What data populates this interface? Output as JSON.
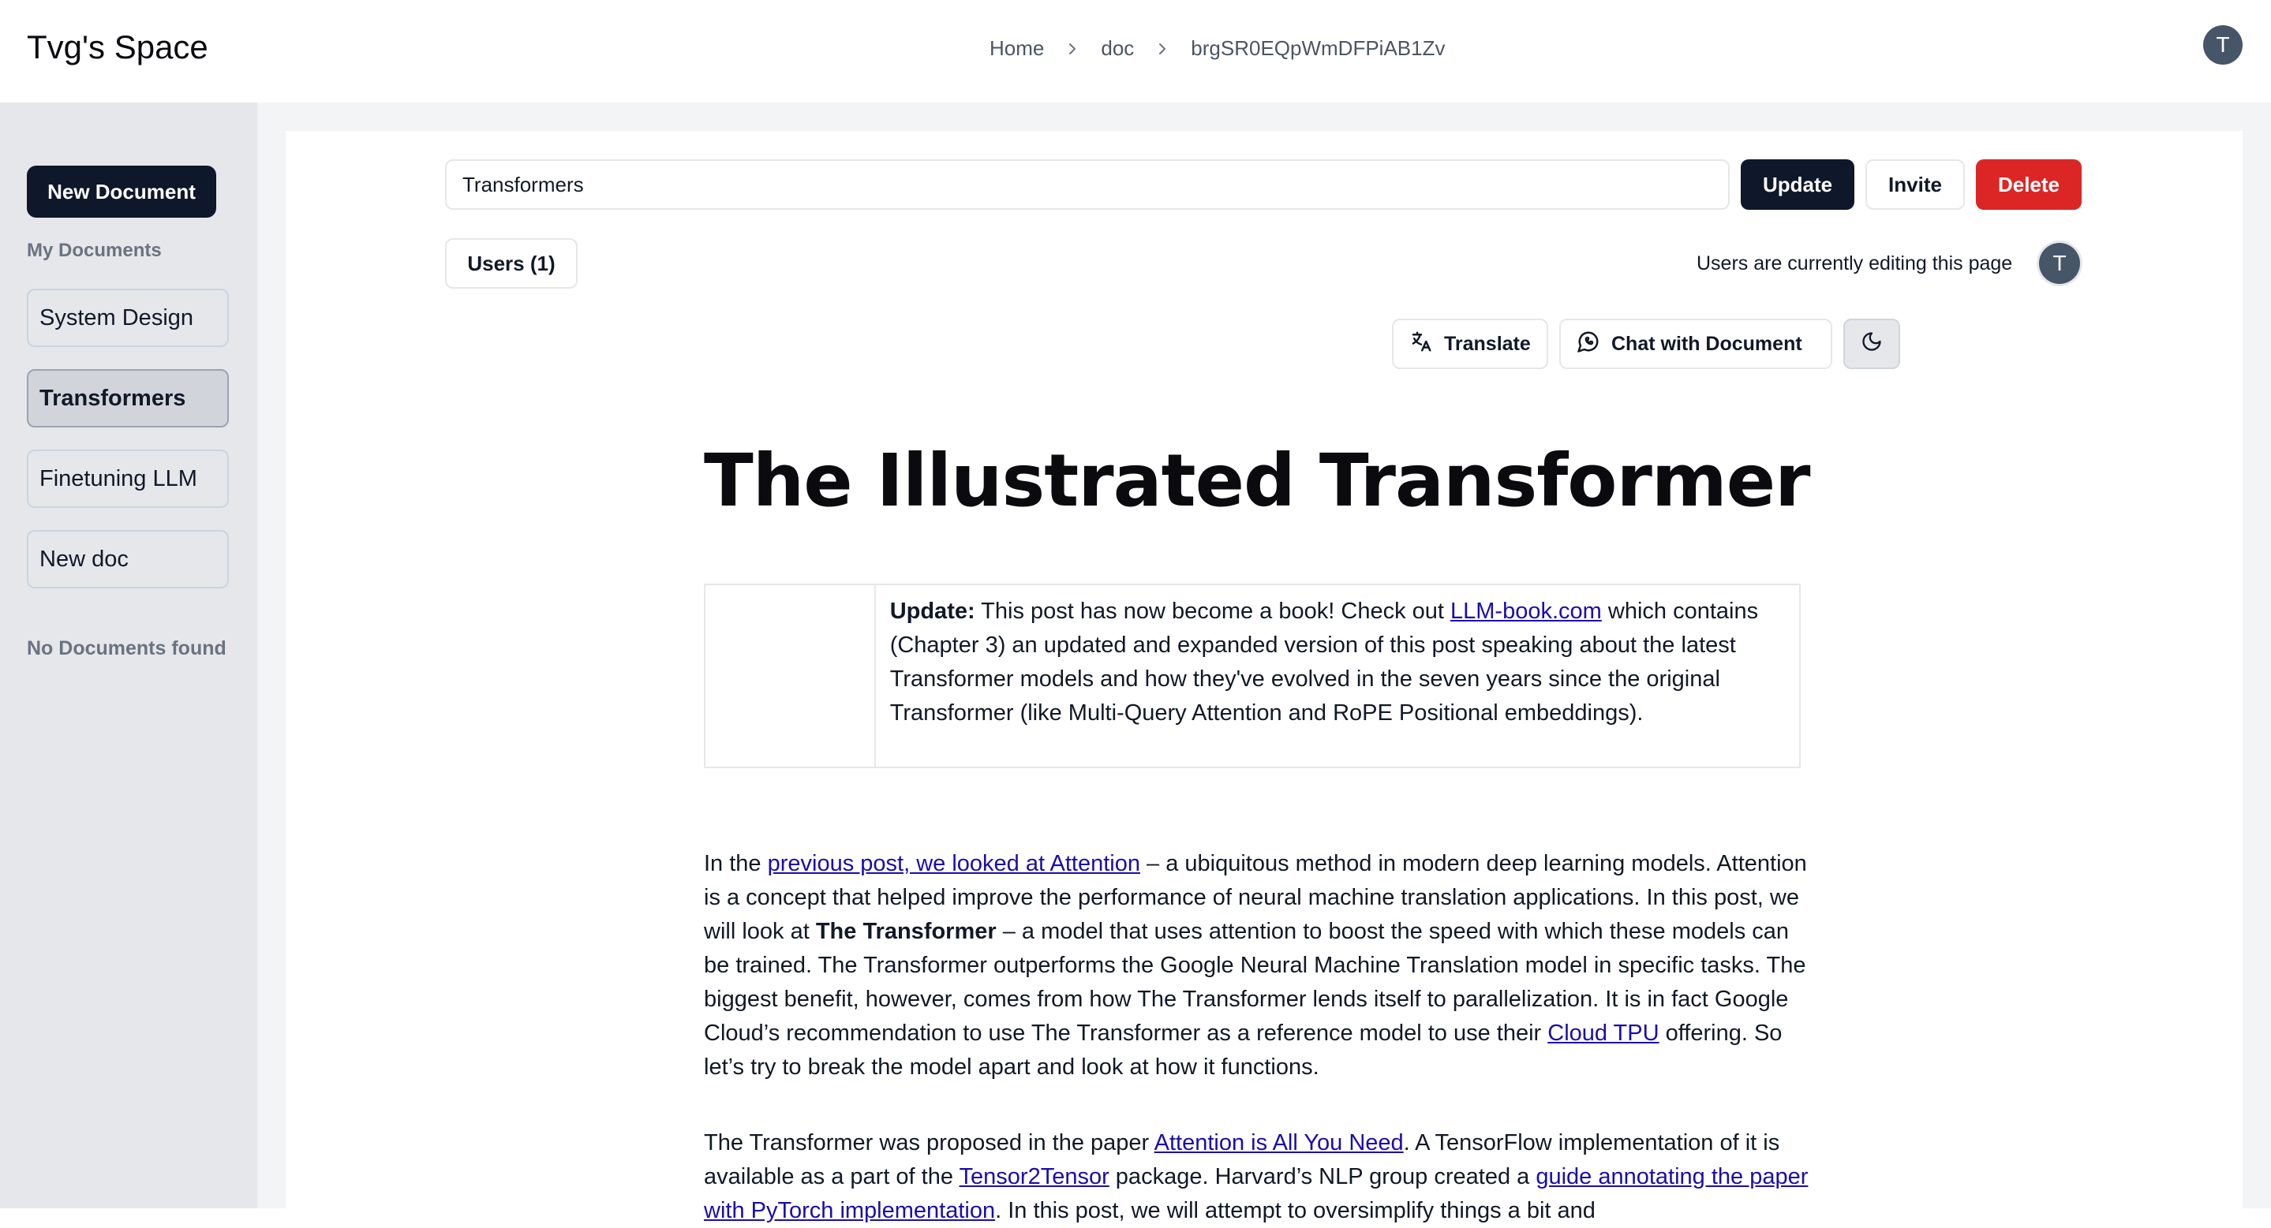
{
  "header": {
    "brand": "Tvg's Space",
    "breadcrumb": [
      "Home",
      "doc",
      "brgSR0EQpWmDFPiAB1Zv"
    ],
    "avatar_initial": "T"
  },
  "sidebar": {
    "new_document_label": "New Document",
    "my_documents_label": "My Documents",
    "items": [
      {
        "label": "System Design",
        "active": false
      },
      {
        "label": "Transformers",
        "active": true
      },
      {
        "label": "Finetuning LLM",
        "active": false
      },
      {
        "label": "New doc",
        "active": false
      }
    ],
    "empty_label": "No Documents found"
  },
  "toolbar": {
    "title_value": "Transformers",
    "update_label": "Update",
    "invite_label": "Invite",
    "delete_label": "Delete",
    "users_label": "Users (1)",
    "editing_text": "Users are currently editing this page",
    "editing_avatar_initial": "T",
    "translate_label": "Translate",
    "chat_label": "Chat with Document"
  },
  "document": {
    "title": "The Illustrated Transformer",
    "update_box": {
      "bold_prefix": "Update:",
      "text_1": " This post has now become a book! Check out ",
      "link": "LLM-book.com",
      "text_2": " which contains (Chapter 3) an updated and expanded version of this post speaking about the latest Transformer models and how they've evolved in the seven years since the original Transformer (like Multi-Query Attention and RoPE Positional embeddings)."
    },
    "p1": {
      "t1": "In the ",
      "link1": "previous post, we looked at Attention",
      "t2": " – a ubiquitous method in modern deep learning models. Attention is a concept that helped improve the performance of neural machine translation applications. In this post, we will look at ",
      "bold": "The Transformer",
      "t3": " – a model that uses attention to boost the speed with which these models can be trained. The Transformer outperforms the Google Neural Machine Translation model in specific tasks. The biggest benefit, however, comes from how The Transformer lends itself to parallelization. It is in fact Google Cloud’s recommendation to use The Transformer as a reference model to use their ",
      "link2": "Cloud TPU",
      "t4": " offering. So let’s try to break the model apart and look at how it functions."
    },
    "p2": {
      "t1": "The Transformer was proposed in the paper ",
      "link1": "Attention is All You Need",
      "t2": ". A TensorFlow implementation of it is available as a part of the ",
      "link2": "Tensor2Tensor",
      "t3": " package. Harvard’s NLP group created a ",
      "link3": "guide annotating the paper with PyTorch implementation",
      "t4": ". In this post, we will attempt to oversimplify things a bit and"
    }
  },
  "colors": {
    "primary": "#0f172a",
    "danger": "#dc2626",
    "sidebar_bg": "#e5e7eb",
    "link": "#1a0dab"
  }
}
